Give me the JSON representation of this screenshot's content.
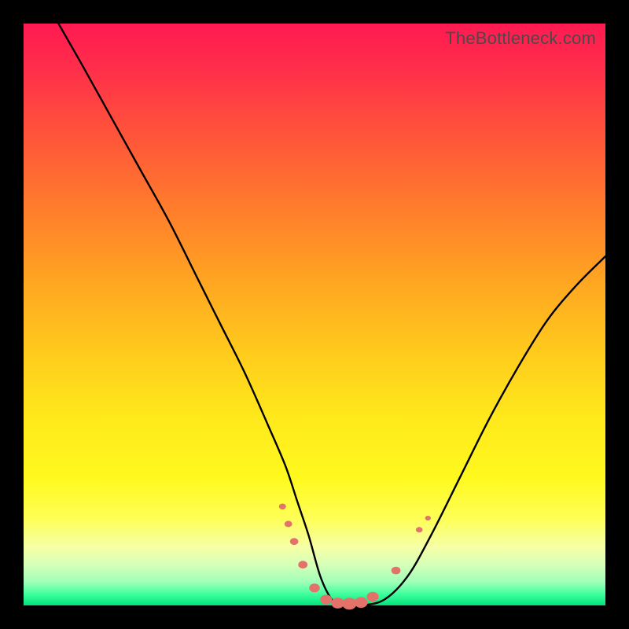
{
  "watermark": "TheBottleneck.com",
  "chart_data": {
    "type": "line",
    "title": "",
    "xlabel": "",
    "ylabel": "",
    "xlim": [
      0,
      100
    ],
    "ylim": [
      0,
      100
    ],
    "grid": false,
    "legend": false,
    "series": [
      {
        "name": "valley-curve",
        "color": "#000000",
        "x": [
          6,
          10,
          15,
          20,
          25,
          30,
          34,
          38,
          42,
          45,
          47,
          49,
          51,
          53,
          55,
          58,
          62,
          66,
          70,
          75,
          80,
          85,
          90,
          95,
          100
        ],
        "y": [
          100,
          93,
          84,
          75,
          66,
          56,
          48,
          40,
          31,
          24,
          18,
          12,
          5,
          1,
          0,
          0,
          1,
          5,
          12,
          22,
          32,
          41,
          49,
          55,
          60
        ]
      }
    ],
    "markers": {
      "color": "#e2726a",
      "points": [
        {
          "x": 44.5,
          "y": 17
        },
        {
          "x": 45.5,
          "y": 14
        },
        {
          "x": 46.5,
          "y": 11
        },
        {
          "x": 48.0,
          "y": 7
        },
        {
          "x": 50.0,
          "y": 3
        },
        {
          "x": 52.0,
          "y": 1
        },
        {
          "x": 54.0,
          "y": 0.4
        },
        {
          "x": 56.0,
          "y": 0.3
        },
        {
          "x": 58.0,
          "y": 0.5
        },
        {
          "x": 60.0,
          "y": 1.5
        },
        {
          "x": 64.0,
          "y": 6
        },
        {
          "x": 68.0,
          "y": 13
        },
        {
          "x": 69.5,
          "y": 15
        }
      ],
      "radius_range": [
        3,
        8
      ]
    }
  }
}
